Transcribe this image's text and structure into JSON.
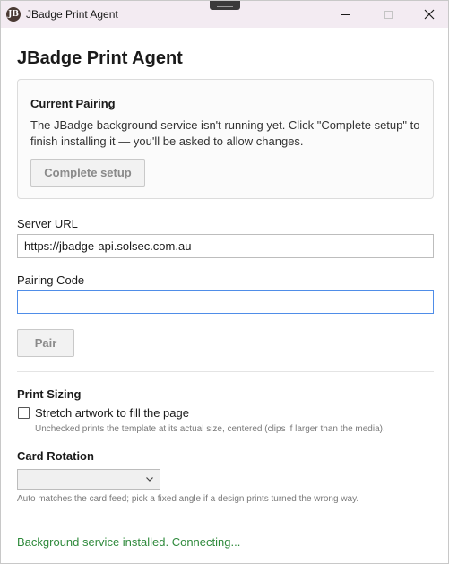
{
  "window": {
    "title": "JBadge Print Agent",
    "icon_letter": "JB"
  },
  "page": {
    "title": "JBadge Print Agent"
  },
  "pairing": {
    "title": "Current Pairing",
    "description": "The JBadge background service isn't running yet. Click \"Complete setup\" to finish installing it — you'll be asked to allow changes.",
    "complete_button": "Complete setup"
  },
  "server": {
    "label": "Server URL",
    "value": "https://jbadge-api.solsec.com.au"
  },
  "pairing_code": {
    "label": "Pairing Code",
    "value": "",
    "placeholder": ""
  },
  "pair_button": "Pair",
  "print_sizing": {
    "title": "Print Sizing",
    "checkbox_label": "Stretch artwork to fill the page",
    "checked": false,
    "hint": "Unchecked prints the template at its actual size, centered (clips if larger than the media)."
  },
  "card_rotation": {
    "title": "Card Rotation",
    "selected": "",
    "hint": "Auto matches the card feed; pick a fixed angle if a design prints turned the wrong way."
  },
  "status": {
    "text": "Background service installed. Connecting...",
    "color": "#2f8a3c"
  },
  "colors": {
    "titlebar": "#f3ebf2",
    "focus_border": "#4f8de8"
  }
}
